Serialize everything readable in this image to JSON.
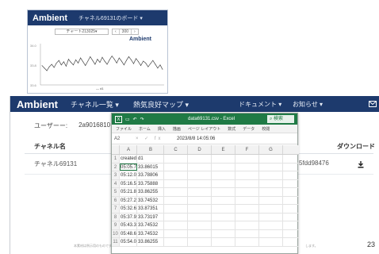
{
  "mini": {
    "brand": "Ambient",
    "board": "チャネル69131のボード ▾",
    "chart_select": "チャート213025▾",
    "pager": [
      "‹",
      "300",
      "›"
    ],
    "chart_label": "Ambient",
    "y_ticks": [
      "34.0",
      "33.8",
      "33.6"
    ],
    "legend": "— d1"
  },
  "nav": {
    "brand": "Ambient",
    "items": [
      "チャネル一覧 ▾",
      "熱気良好マップ ▾"
    ],
    "right": [
      "ドキュメント ▾",
      "お知らせ ▾"
    ],
    "mail_icon": "mail-icon"
  },
  "user": {
    "label": "ユーザーー:",
    "value": "2a9016810"
  },
  "table": {
    "headers": [
      "チャネル名",
      "ダウンロード"
    ],
    "row": {
      "name": "チャネル69131",
      "id_tail": "5fdd98476"
    }
  },
  "footer": {
    "left": "本素材は例示用のものです",
    "right": "します。",
    "page": "23"
  },
  "excel": {
    "filename": "data69131.csv - Excel",
    "search": "検索",
    "ribbon": [
      "ファイル",
      "ホーム",
      "挿入",
      "描画",
      "ページ レイアウト",
      "数式",
      "データ",
      "校閲"
    ],
    "cellref": "A2",
    "formula_btns": "× ✓ fx",
    "formula_value": "2023/8/8 14:05:06",
    "columns": [
      "",
      "A",
      "B",
      "C",
      "D",
      "E",
      "F",
      "G"
    ],
    "rows": [
      [
        "1",
        "created",
        "d1"
      ],
      [
        "2",
        "05:05.7",
        "33.86015"
      ],
      [
        "3",
        "05:12.0",
        "33.78806"
      ],
      [
        "4",
        "05:16.5",
        "33.75888"
      ],
      [
        "5",
        "05:21.8",
        "33.86255"
      ],
      [
        "6",
        "05:27.2",
        "33.74532"
      ],
      [
        "7",
        "05:32.6",
        "33.87351"
      ],
      [
        "8",
        "05:37.9",
        "33.73197"
      ],
      [
        "9",
        "05:43.3",
        "33.74532"
      ],
      [
        "10",
        "05:48.6",
        "33.74532"
      ],
      [
        "11",
        "05:54.0",
        "33.86255"
      ]
    ]
  },
  "chart_data": {
    "type": "line",
    "title": "Ambient",
    "ylabel": "",
    "ylim": [
      33.5,
      34.1
    ],
    "series": [
      {
        "name": "d1",
        "values": [
          33.78,
          33.74,
          33.7,
          33.76,
          33.8,
          33.75,
          33.82,
          33.86,
          33.79,
          33.84,
          33.77,
          33.88,
          33.83,
          33.79,
          33.87,
          33.82,
          33.9,
          33.84,
          33.78,
          33.85,
          33.92,
          33.86,
          33.8,
          33.88,
          33.83,
          33.91,
          33.85,
          33.8,
          33.87,
          33.93,
          33.88,
          33.82,
          33.9,
          33.85,
          33.79,
          33.86,
          33.92,
          33.87,
          33.81,
          33.89,
          33.84,
          33.78,
          33.85,
          33.82,
          33.76,
          33.81,
          33.86,
          33.8,
          33.74,
          33.79,
          33.72
        ]
      }
    ],
    "grid": false,
    "legend": "bottom"
  }
}
